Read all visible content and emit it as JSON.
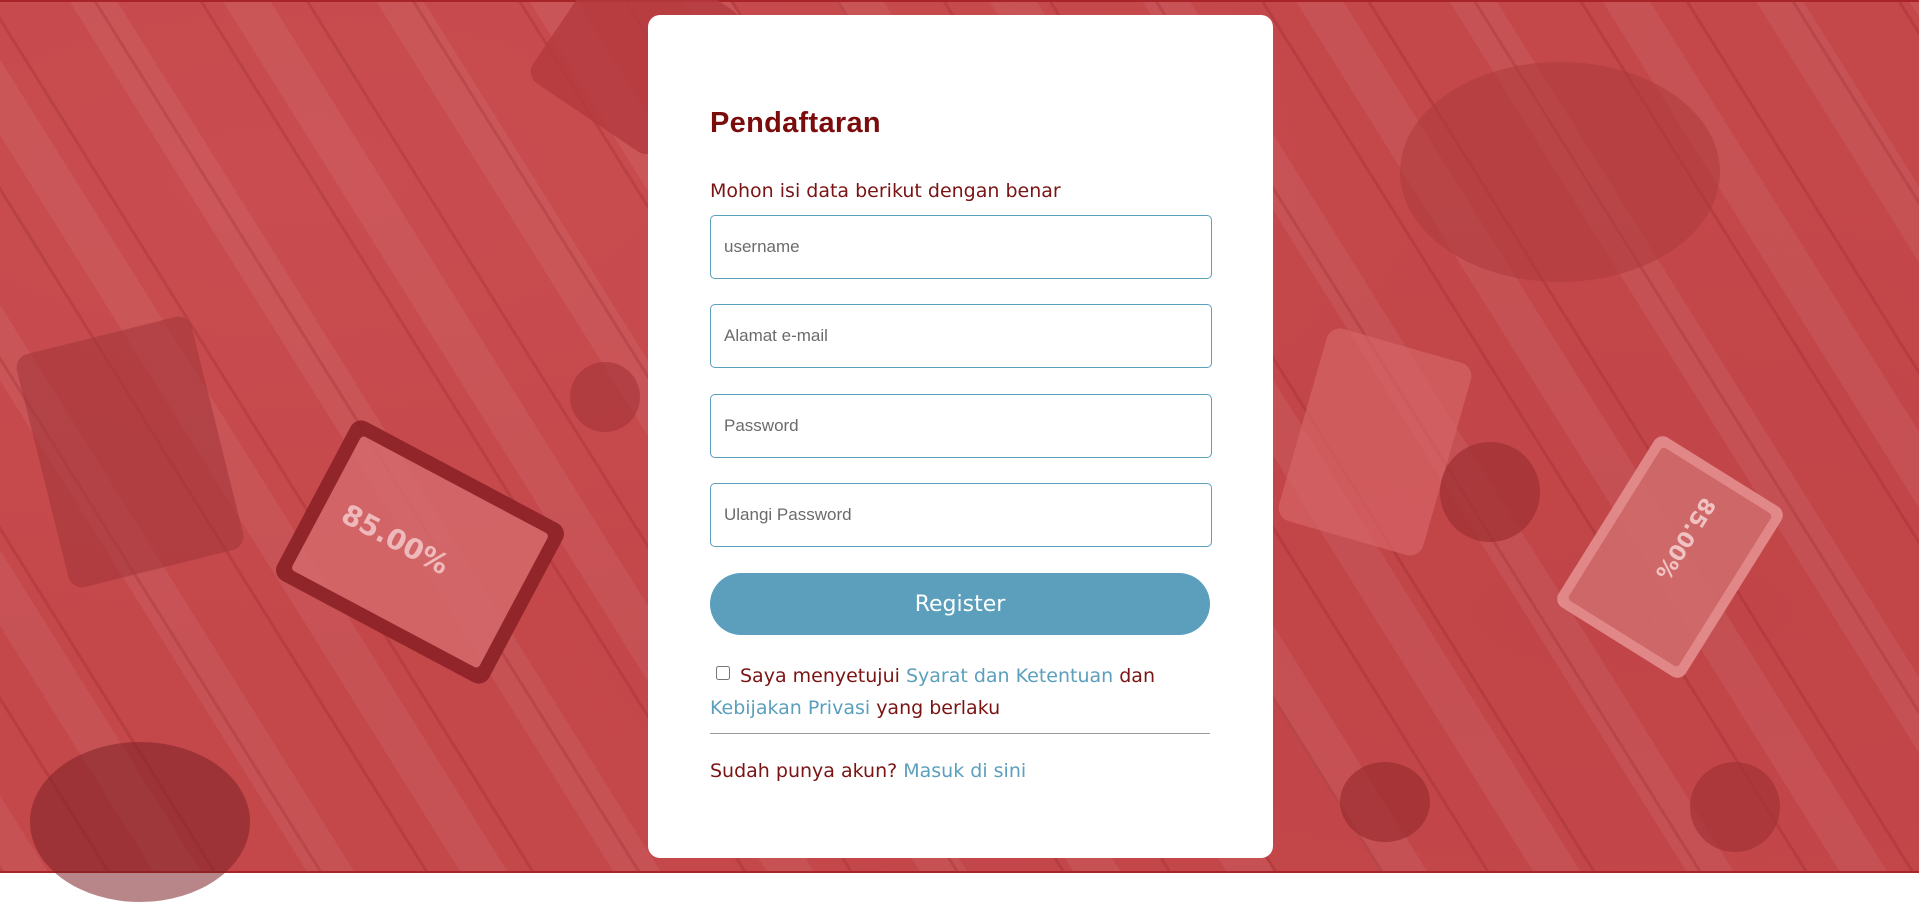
{
  "background": {
    "tablet_left_text": "85.00%",
    "tablet_right_text": "85.00%"
  },
  "form": {
    "title": "Pendaftaran",
    "subtitle": "Mohon isi data berikut dengan benar",
    "fields": [
      {
        "placeholder": "username",
        "value": ""
      },
      {
        "placeholder": "Alamat e-mail",
        "value": ""
      },
      {
        "placeholder": "Password",
        "value": ""
      },
      {
        "placeholder": "Ulangi Password",
        "value": ""
      }
    ],
    "register_label": "Register",
    "agree": {
      "checked": false,
      "prefix": "Saya menyetujui",
      "terms_link": "Syarat dan Ketentuan",
      "middle": "dan",
      "privacy_link": "Kebijakan Privasi",
      "suffix": "yang berlaku"
    },
    "login": {
      "prompt": "Sudah punya akun?",
      "link": "Masuk di sini"
    }
  },
  "colors": {
    "accent": "#5b9fbc",
    "title": "#7a0c0c",
    "background": "#c4474a"
  }
}
